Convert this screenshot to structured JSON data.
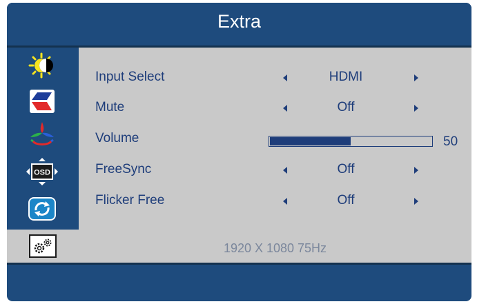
{
  "header": {
    "title": "Extra"
  },
  "sidebar": {
    "items": [
      {
        "name": "brightness-contrast",
        "icon": "brightness-contrast-icon"
      },
      {
        "name": "image",
        "icon": "image-setup-icon"
      },
      {
        "name": "color",
        "icon": "color-setup-icon"
      },
      {
        "name": "osd",
        "icon": "osd-setup-icon",
        "label": "OSD"
      },
      {
        "name": "reset",
        "icon": "reset-icon"
      },
      {
        "name": "extra",
        "icon": "gear-icon",
        "active": true
      }
    ]
  },
  "menu": {
    "input_select": {
      "label": "Input Select",
      "value": "HDMI"
    },
    "mute": {
      "label": "Mute",
      "value": "Off"
    },
    "volume": {
      "label": "Volume",
      "value": "50",
      "level": 50,
      "max": 100
    },
    "freesync": {
      "label": "FreeSync",
      "value": "Off"
    },
    "flicker_free": {
      "label": "Flicker Free",
      "value": "Off"
    }
  },
  "status": {
    "resolution": "1920 X 1080 75Hz"
  },
  "colors": {
    "frame": "#1e4b7d",
    "panel": "#c9c9c9",
    "text": "#1e3d7a",
    "status_text": "#7b879c"
  }
}
